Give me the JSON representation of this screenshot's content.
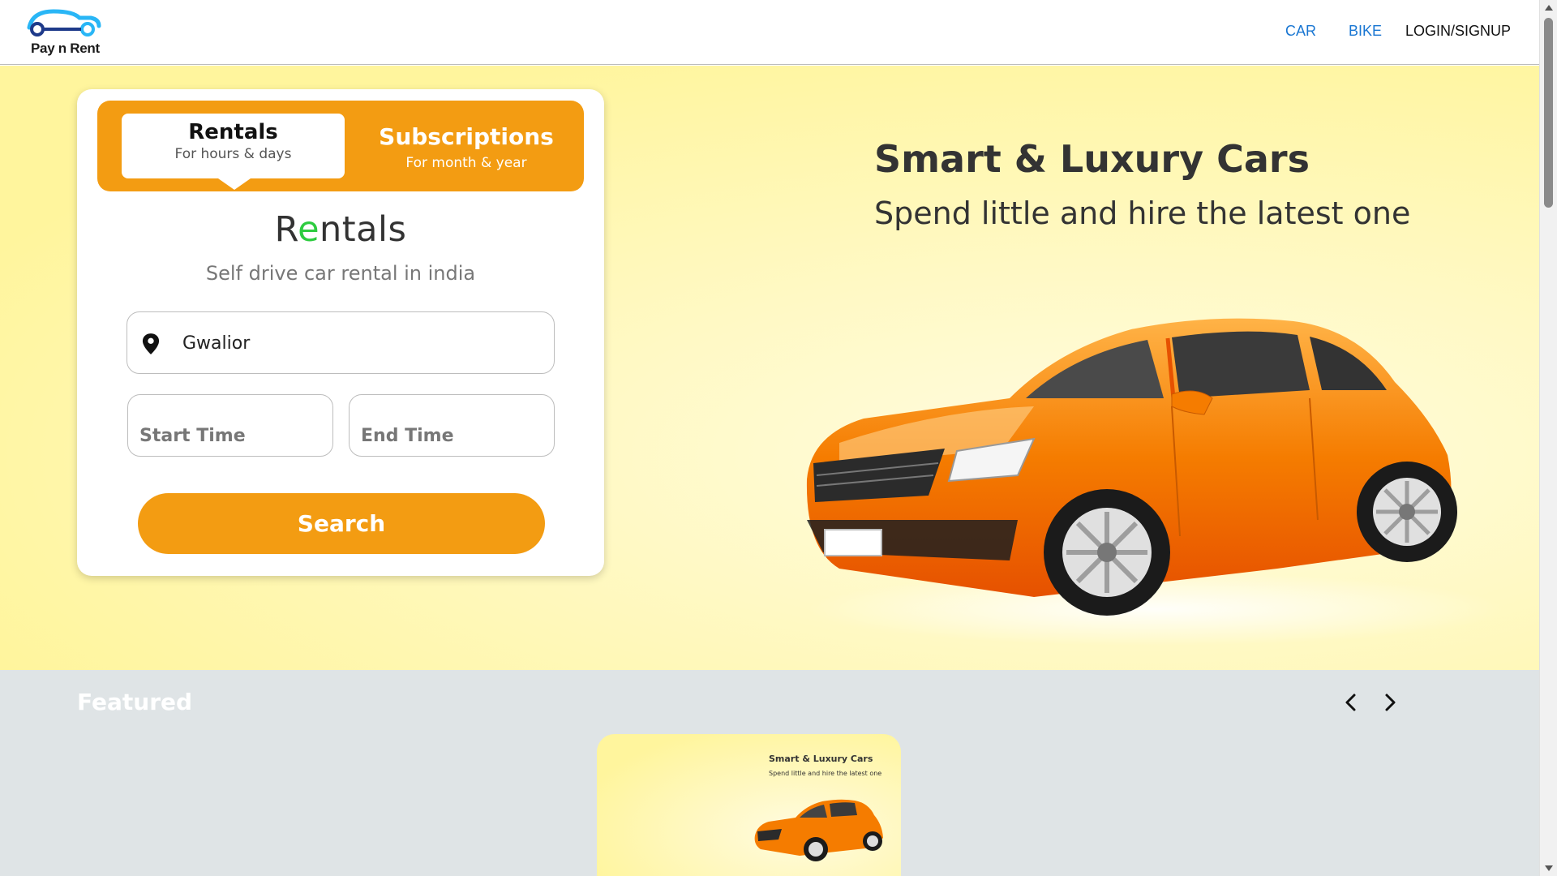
{
  "brand": {
    "name": "Pay n Rent"
  },
  "nav": {
    "car": "CAR",
    "bike": "BIKE",
    "login": "LOGIN/SIGNUP"
  },
  "booking": {
    "tabs": [
      {
        "title": "Rentals",
        "subtitle": "For hours & days",
        "active": true
      },
      {
        "title": "Subscriptions",
        "subtitle": "For month & year",
        "active": false
      }
    ],
    "heading_first": "R",
    "heading_green": "e",
    "heading_rest": "ntals",
    "tagline": "Self drive car rental in india",
    "location_value": "Gwalior",
    "start_placeholder": "Start Time",
    "end_placeholder": "End Time",
    "search_label": "Search"
  },
  "hero": {
    "title": "Smart & Luxury Cars",
    "subtitle": "Spend little and hire the latest one"
  },
  "featured": {
    "title": "Featured",
    "card_title": "Smart & Luxury Cars",
    "card_subtitle": "Spend little and hire the latest one"
  },
  "colors": {
    "accent": "#f39c12",
    "nav_link": "#1976d2",
    "hero_bg": "#fff59d",
    "featured_bg": "#dfe4e6",
    "brand_blue": "#29b6f6"
  }
}
